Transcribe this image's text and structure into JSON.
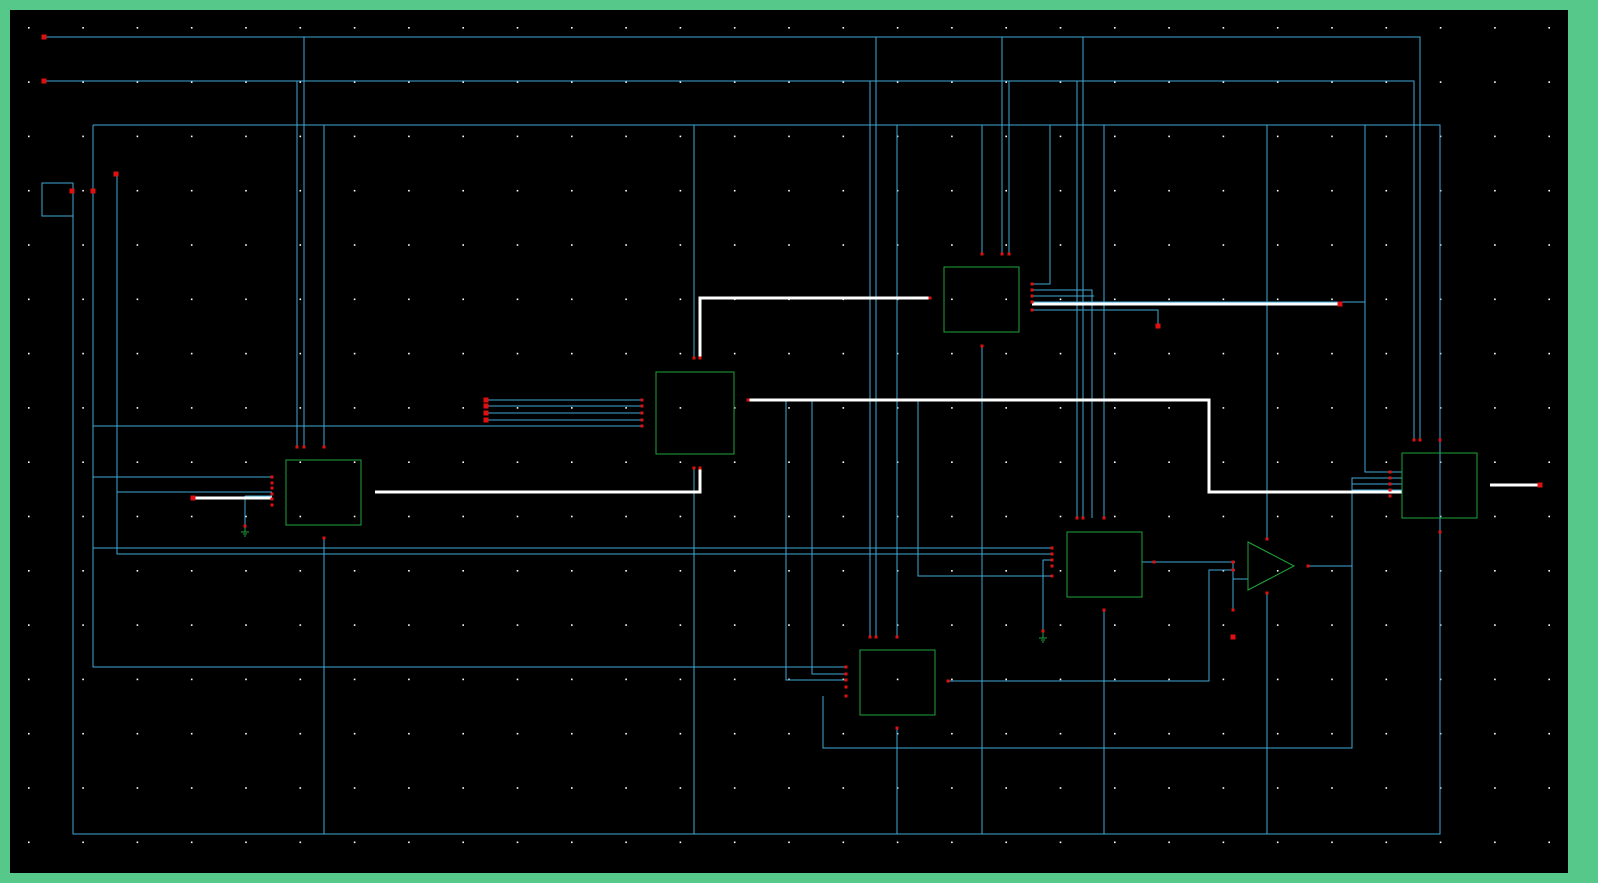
{
  "theme": {
    "frame_color": "#56C98A",
    "background": "#000000",
    "grid_dot": "#FFFFFF",
    "wire": "#3FA7D6",
    "bus": "#FFFFFF",
    "instance_outline": "#1FA53A",
    "pin": "#E01010",
    "ground": "#1FA53A"
  },
  "schematic": {
    "instances": [
      {
        "id": "inst-a",
        "kind": "block"
      },
      {
        "id": "inst-b",
        "kind": "block"
      },
      {
        "id": "inst-c",
        "kind": "block"
      },
      {
        "id": "inst-d",
        "kind": "block"
      },
      {
        "id": "inst-e",
        "kind": "block"
      },
      {
        "id": "inst-f",
        "kind": "block"
      },
      {
        "id": "inst-amp",
        "kind": "buffer-triangle"
      }
    ],
    "grounds": 2
  }
}
